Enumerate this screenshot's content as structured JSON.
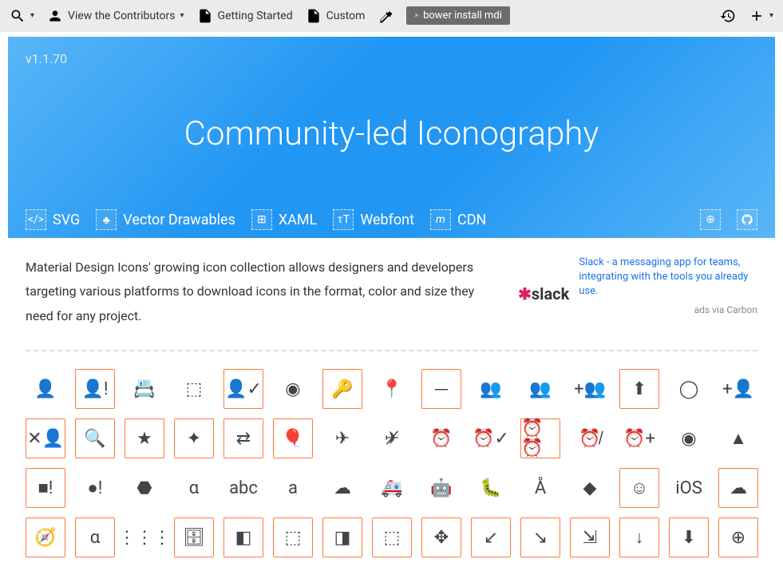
{
  "toolbar": {
    "contributors": "View the Contributors",
    "getting_started": "Getting Started",
    "custom": "Custom",
    "command": "bower install mdi"
  },
  "hero": {
    "version": "v1.1.70",
    "title": "Community-led Iconography",
    "tabs": {
      "svg": "SVG",
      "vector": "Vector Drawables",
      "xaml": "XAML",
      "webfont": "Webfont",
      "cdn": "CDN"
    }
  },
  "intro": "Material Design Icons' growing icon collection allows designers and developers targeting various platforms to download icons in the format, color and size they need for any project.",
  "ad": {
    "logo_text": "slack",
    "text": "Slack - a messaging app for teams, integrating with the tools you already use.",
    "sub": "ads via Carbon"
  },
  "icons": [
    {
      "n": "account",
      "s": false
    },
    {
      "n": "account-alert",
      "s": true
    },
    {
      "n": "account-box",
      "s": false
    },
    {
      "n": "account-box-outline",
      "s": false
    },
    {
      "n": "account-check",
      "s": true
    },
    {
      "n": "account-circle",
      "s": false
    },
    {
      "n": "account-key",
      "s": true
    },
    {
      "n": "account-location",
      "s": false
    },
    {
      "n": "account-minus",
      "s": true
    },
    {
      "n": "account-multiple",
      "s": false
    },
    {
      "n": "account-multiple-outline",
      "s": false
    },
    {
      "n": "account-multiple-plus",
      "s": false
    },
    {
      "n": "account-network",
      "s": true
    },
    {
      "n": "account-outline",
      "s": false
    },
    {
      "n": "account-plus",
      "s": false
    },
    {
      "n": "account-remove",
      "s": true
    },
    {
      "n": "account-search",
      "s": true
    },
    {
      "n": "account-star",
      "s": true
    },
    {
      "n": "account-star-variant",
      "s": true
    },
    {
      "n": "account-switch",
      "s": true
    },
    {
      "n": "air-balloon",
      "s": true
    },
    {
      "n": "airplane",
      "s": false
    },
    {
      "n": "airplane-off",
      "s": false
    },
    {
      "n": "alarm",
      "s": false
    },
    {
      "n": "alarm-check",
      "s": false
    },
    {
      "n": "alarm-multiple",
      "s": true
    },
    {
      "n": "alarm-off",
      "s": false
    },
    {
      "n": "alarm-plus",
      "s": false
    },
    {
      "n": "album",
      "s": false
    },
    {
      "n": "alert",
      "s": false
    },
    {
      "n": "alert-box",
      "s": true
    },
    {
      "n": "alert-circle",
      "s": false
    },
    {
      "n": "alert-octagon",
      "s": false
    },
    {
      "n": "alpha",
      "s": false
    },
    {
      "n": "alphabetical",
      "s": false
    },
    {
      "n": "amazon",
      "s": false
    },
    {
      "n": "amazon-clouddrive",
      "s": false
    },
    {
      "n": "ambulance",
      "s": false
    },
    {
      "n": "android",
      "s": false
    },
    {
      "n": "android-debug-bridge",
      "s": false
    },
    {
      "n": "android-studio",
      "s": false
    },
    {
      "n": "apple",
      "s": false
    },
    {
      "n": "apple-finder",
      "s": true
    },
    {
      "n": "apple-ios",
      "s": false
    },
    {
      "n": "apple-mobileme",
      "s": true
    },
    {
      "n": "apple-safari",
      "s": true
    },
    {
      "n": "appnet",
      "s": true
    },
    {
      "n": "apps",
      "s": false
    },
    {
      "n": "archive",
      "s": true
    },
    {
      "n": "arrange-bring-forward",
      "s": true
    },
    {
      "n": "arrange-bring-to-front",
      "s": true
    },
    {
      "n": "arrange-send-backward",
      "s": true
    },
    {
      "n": "arrange-send-to-back",
      "s": true
    },
    {
      "n": "arrow-all",
      "s": true
    },
    {
      "n": "arrow-bottom-left",
      "s": true
    },
    {
      "n": "arrow-bottom-right",
      "s": true
    },
    {
      "n": "arrow-collapse",
      "s": true
    },
    {
      "n": "arrow-down",
      "s": true
    },
    {
      "n": "arrow-down-bold",
      "s": true
    },
    {
      "n": "arrow-down-bold-circle",
      "s": true
    }
  ],
  "glyphs": {
    "account": "👤",
    "account-alert": "👤!",
    "account-box": "📇",
    "account-box-outline": "⬚",
    "account-check": "👤✓",
    "account-circle": "◉",
    "account-key": "🔑",
    "account-location": "📍",
    "account-minus": "－",
    "account-multiple": "👥",
    "account-multiple-outline": "👥",
    "account-multiple-plus": "+👥",
    "account-network": "⬆",
    "account-outline": "◯",
    "account-plus": "+👤",
    "account-remove": "✕👤",
    "account-search": "🔍",
    "account-star": "★",
    "account-star-variant": "✦",
    "account-switch": "⇄",
    "air-balloon": "🎈",
    "airplane": "✈",
    "airplane-off": "✈̸",
    "alarm": "⏰",
    "alarm-check": "⏰✓",
    "alarm-multiple": "⏰⏰",
    "alarm-off": "⏰̸",
    "alarm-plus": "⏰+",
    "album": "◉",
    "alert": "▲",
    "alert-box": "■!",
    "alert-circle": "●!",
    "alert-octagon": "⬣",
    "alpha": "α",
    "alphabetical": "abc",
    "amazon": "a",
    "amazon-clouddrive": "☁",
    "ambulance": "🚑",
    "android": "🤖",
    "android-debug-bridge": "🐛",
    "android-studio": "Å",
    "apple": "",
    "apple-finder": "☺",
    "apple-ios": "iOS",
    "apple-mobileme": "☁",
    "apple-safari": "🧭",
    "appnet": "α",
    "apps": "⋮⋮⋮",
    "archive": "🗄",
    "arrange-bring-forward": "◧",
    "arrange-bring-to-front": "⬚",
    "arrange-send-backward": "◨",
    "arrange-send-to-back": "⬚",
    "arrow-all": "✥",
    "arrow-bottom-left": "↙",
    "arrow-bottom-right": "↘",
    "arrow-collapse": "⇲",
    "arrow-down": "↓",
    "arrow-down-bold": "⬇",
    "arrow-down-bold-circle": "⊕"
  }
}
